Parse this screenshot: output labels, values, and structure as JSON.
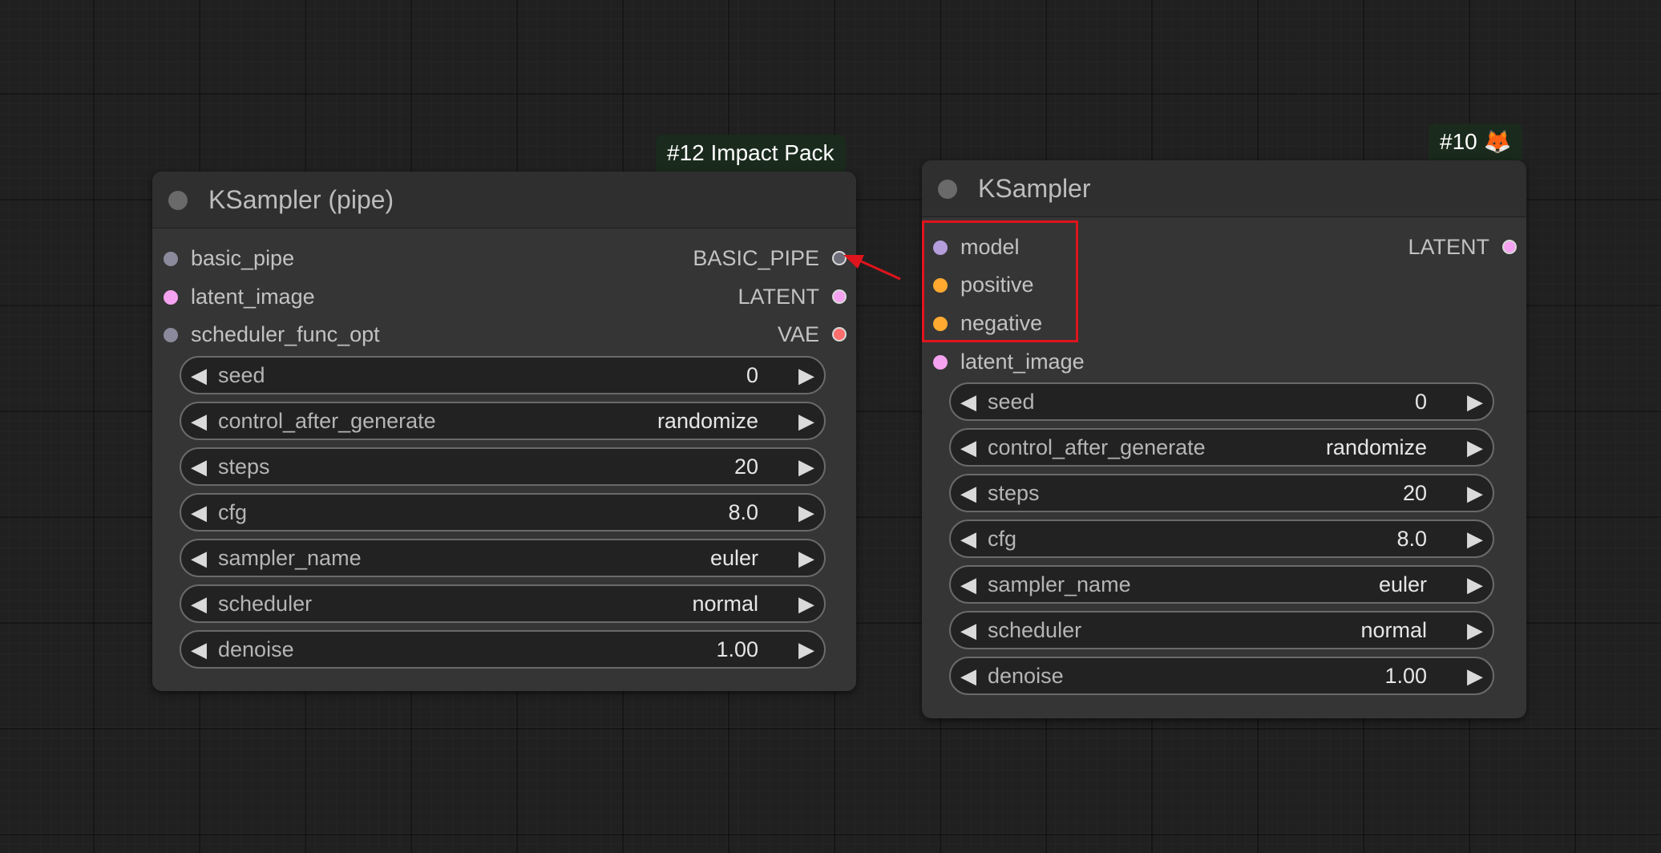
{
  "nodes": [
    {
      "badge": "#12 Impact Pack",
      "title": "KSampler (pipe)",
      "inputs": [
        {
          "label": "basic_pipe",
          "color": "#8a8a9c"
        },
        {
          "label": "latent_image",
          "color": "#f5a3f0"
        },
        {
          "label": "scheduler_func_opt",
          "color": "#8a8a9c"
        }
      ],
      "outputs": [
        {
          "label": "BASIC_PIPE",
          "color": "#6e6e7a"
        },
        {
          "label": "LATENT",
          "color": "#f5a3f0"
        },
        {
          "label": "VAE",
          "color": "#ff6e6e"
        }
      ],
      "widgets": [
        {
          "name": "seed",
          "value": "0"
        },
        {
          "name": "control_after_generate",
          "value": "randomize"
        },
        {
          "name": "steps",
          "value": "20"
        },
        {
          "name": "cfg",
          "value": "8.0"
        },
        {
          "name": "sampler_name",
          "value": "euler"
        },
        {
          "name": "scheduler",
          "value": "normal"
        },
        {
          "name": "denoise",
          "value": "1.00"
        }
      ]
    },
    {
      "badge": "#10 🦊",
      "title": "KSampler",
      "inputs": [
        {
          "label": "model",
          "color": "#b39ddb"
        },
        {
          "label": "positive",
          "color": "#ffa931"
        },
        {
          "label": "negative",
          "color": "#ffa931"
        },
        {
          "label": "latent_image",
          "color": "#f5a3f0"
        }
      ],
      "outputs": [
        {
          "label": "LATENT",
          "color": "#f5a3f0"
        }
      ],
      "widgets": [
        {
          "name": "seed",
          "value": "0"
        },
        {
          "name": "control_after_generate",
          "value": "randomize"
        },
        {
          "name": "steps",
          "value": "20"
        },
        {
          "name": "cfg",
          "value": "8.0"
        },
        {
          "name": "sampler_name",
          "value": "euler"
        },
        {
          "name": "scheduler",
          "value": "normal"
        },
        {
          "name": "denoise",
          "value": "1.00"
        }
      ]
    }
  ],
  "glyphs": {
    "left_arrow": "◀",
    "right_arrow": "▶"
  },
  "annotation": {
    "highlight_color": "#e0141c",
    "arrow_color": "#e0141c"
  }
}
